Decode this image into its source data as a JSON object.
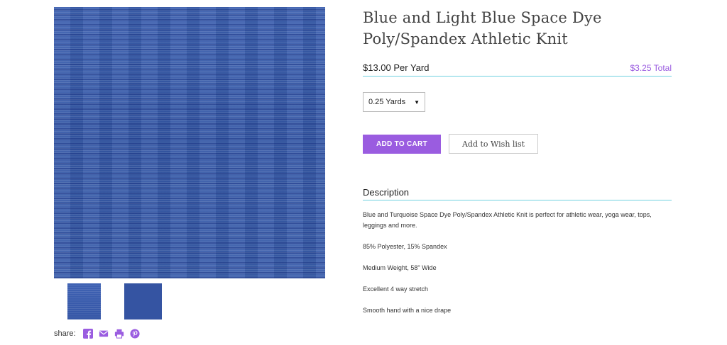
{
  "product": {
    "title": "Blue and Light Blue Space Dye Poly/Spandex Athletic Knit",
    "price": "$13.00 Per Yard",
    "total": "$3.25 Total",
    "quantity_selected": "0.25 Yards",
    "add_to_cart_label": "ADD TO CART",
    "wishlist_label": "Add to Wish list"
  },
  "description": {
    "heading": "Description",
    "paragraphs": [
      "Blue and Turquoise Space Dye Poly/Spandex Athletic Knit is perfect for athletic wear, yoga wear, tops, leggings and more.",
      "85% Polyester, 15% Spandex",
      "Medium Weight, 58\" Wide",
      "Excellent 4 way stretch",
      "Smooth hand with a nice drape"
    ]
  },
  "share": {
    "label": "share:",
    "icons": [
      "facebook-icon",
      "email-icon",
      "print-icon",
      "pinterest-icon"
    ]
  },
  "colors": {
    "accent": "#9a5ce0",
    "divider": "#6fd1e0",
    "fabric_blue": "#3a5eaa"
  }
}
